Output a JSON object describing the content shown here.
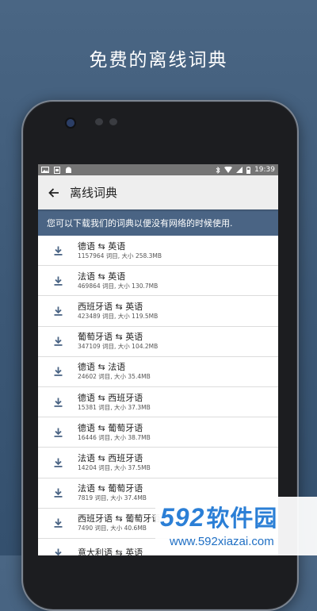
{
  "headline": "免费的离线词典",
  "status_bar": {
    "time": "19:39"
  },
  "app_bar": {
    "title": "离线词典"
  },
  "banner": "您可以下载我们的词典以便没有网络的时候使用.",
  "dictionaries": [
    {
      "pair": "德语 ⇆ 英语",
      "meta": "1157964 词目, 大小 258.3MB"
    },
    {
      "pair": "法语 ⇆ 英语",
      "meta": "469864 词目, 大小 130.7MB"
    },
    {
      "pair": "西班牙语 ⇆ 英语",
      "meta": "423489 词目, 大小 119.5MB"
    },
    {
      "pair": "葡萄牙语 ⇆ 英语",
      "meta": "347109 词目, 大小 104.2MB"
    },
    {
      "pair": "德语 ⇆ 法语",
      "meta": "24602 词目, 大小 35.4MB"
    },
    {
      "pair": "德语 ⇆ 西班牙语",
      "meta": "15381 词目, 大小 37.3MB"
    },
    {
      "pair": "德语 ⇆ 葡萄牙语",
      "meta": "16446 词目, 大小 38.7MB"
    },
    {
      "pair": "法语 ⇆ 西班牙语",
      "meta": "14204 词目, 大小 37.5MB"
    },
    {
      "pair": "法语 ⇆ 葡萄牙语",
      "meta": "7819 词目, 大小 37.4MB"
    },
    {
      "pair": "西班牙语 ⇆ 葡萄牙语",
      "meta": "7490 词目, 大小 40.6MB"
    },
    {
      "pair": "意大利语 ⇆ 英语",
      "meta": ""
    }
  ],
  "watermark": {
    "logo_number": "592",
    "logo_text": "软件园",
    "url": "www.592xiazai.com"
  },
  "colors": {
    "banner": "#4a6484",
    "status_bar": "#757575",
    "app_bar": "#eeeeee",
    "accent": "#4a6484"
  }
}
